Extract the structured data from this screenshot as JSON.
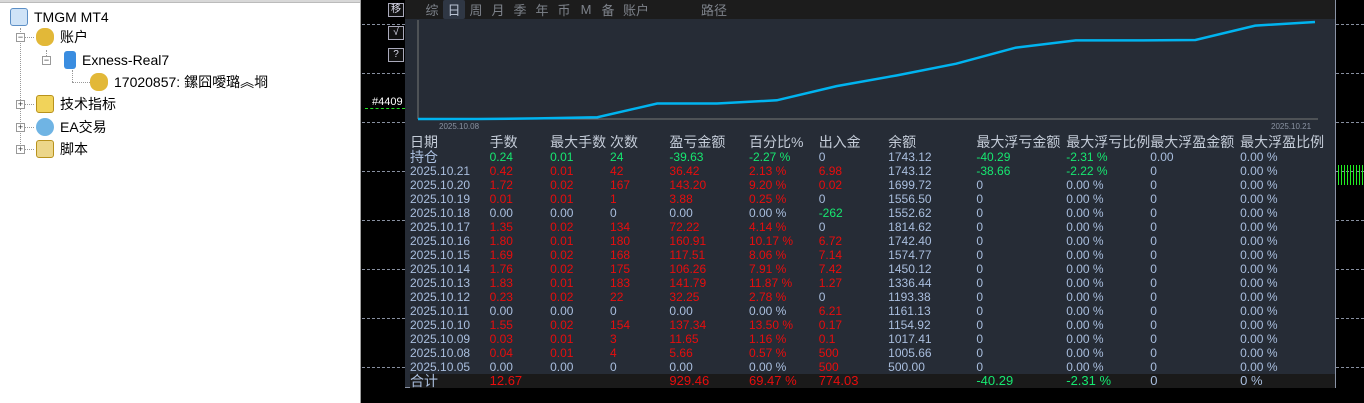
{
  "navigator": {
    "root": "TMGM MT4",
    "accounts": "账户",
    "server": "Exness-Real7",
    "account": "17020857: 鏍囧噯璐︽埛",
    "indicators": "技术指标",
    "experts": "EA交易",
    "scripts": "脚本"
  },
  "side_buttons": [
    "移",
    "√",
    "?"
  ],
  "chart_label": "#4409",
  "toolbar": [
    "综",
    "日",
    "周",
    "月",
    "季",
    "年",
    "币",
    "M",
    "备",
    "账户",
    "路径"
  ],
  "toolbar_active": "日",
  "equity_chart": {
    "start_label": "2025.10.08",
    "end_label": "2025.10.21",
    "line_color": "#00b4f0"
  },
  "colors": {
    "red": "#e80d0d",
    "green": "#16e870",
    "neutral": "#a9bede"
  },
  "headers": [
    "日期",
    "手数",
    "最大手数",
    "次数",
    "盈亏金额",
    "百分比%",
    "出入金",
    "余额",
    "最大浮亏金额",
    "最大浮亏比例",
    "最大浮盈金额",
    "最大浮盈比例"
  ],
  "rows": [
    {
      "c": [
        "持仓",
        "0.24",
        "0.01",
        "24",
        "-39.63",
        "-2.27 %",
        "0",
        "1743.12",
        "-40.29",
        "-2.31 %",
        "0.00",
        "0.00 %"
      ],
      "s": [
        "n",
        "g",
        "g",
        "g",
        "g",
        "g",
        "n",
        "n",
        "g",
        "g",
        "n",
        "n"
      ]
    },
    {
      "c": [
        "2025.10.21",
        "0.42",
        "0.01",
        "42",
        "36.42",
        "2.13 %",
        "6.98",
        "1743.12",
        "-38.66",
        "-2.22 %",
        "0",
        "0.00 %"
      ],
      "s": [
        "n",
        "r",
        "r",
        "r",
        "r",
        "r",
        "r",
        "n",
        "g",
        "g",
        "n",
        "n"
      ]
    },
    {
      "c": [
        "2025.10.20",
        "1.72",
        "0.02",
        "167",
        "143.20",
        "9.20 %",
        "0.02",
        "1699.72",
        "0",
        "0.00 %",
        "0",
        "0.00 %"
      ],
      "s": [
        "n",
        "r",
        "r",
        "r",
        "r",
        "r",
        "r",
        "n",
        "n",
        "n",
        "n",
        "n"
      ]
    },
    {
      "c": [
        "2025.10.19",
        "0.01",
        "0.01",
        "1",
        "3.88",
        "0.25 %",
        "0",
        "1556.50",
        "0",
        "0.00 %",
        "0",
        "0.00 %"
      ],
      "s": [
        "n",
        "r",
        "r",
        "r",
        "r",
        "r",
        "n",
        "n",
        "n",
        "n",
        "n",
        "n"
      ]
    },
    {
      "c": [
        "2025.10.18",
        "0.00",
        "0.00",
        "0",
        "0.00",
        "0.00 %",
        "-262",
        "1552.62",
        "0",
        "0.00 %",
        "0",
        "0.00 %"
      ],
      "s": [
        "n",
        "n",
        "n",
        "n",
        "n",
        "n",
        "g",
        "n",
        "n",
        "n",
        "n",
        "n"
      ]
    },
    {
      "c": [
        "2025.10.17",
        "1.35",
        "0.02",
        "134",
        "72.22",
        "4.14 %",
        "0",
        "1814.62",
        "0",
        "0.00 %",
        "0",
        "0.00 %"
      ],
      "s": [
        "n",
        "r",
        "r",
        "r",
        "r",
        "r",
        "n",
        "n",
        "n",
        "n",
        "n",
        "n"
      ]
    },
    {
      "c": [
        "2025.10.16",
        "1.80",
        "0.01",
        "180",
        "160.91",
        "10.17 %",
        "6.72",
        "1742.40",
        "0",
        "0.00 %",
        "0",
        "0.00 %"
      ],
      "s": [
        "n",
        "r",
        "r",
        "r",
        "r",
        "r",
        "r",
        "n",
        "n",
        "n",
        "n",
        "n"
      ]
    },
    {
      "c": [
        "2025.10.15",
        "1.69",
        "0.02",
        "168",
        "117.51",
        "8.06 %",
        "7.14",
        "1574.77",
        "0",
        "0.00 %",
        "0",
        "0.00 %"
      ],
      "s": [
        "n",
        "r",
        "r",
        "r",
        "r",
        "r",
        "r",
        "n",
        "n",
        "n",
        "n",
        "n"
      ]
    },
    {
      "c": [
        "2025.10.14",
        "1.76",
        "0.02",
        "175",
        "106.26",
        "7.91 %",
        "7.42",
        "1450.12",
        "0",
        "0.00 %",
        "0",
        "0.00 %"
      ],
      "s": [
        "n",
        "r",
        "r",
        "r",
        "r",
        "r",
        "r",
        "n",
        "n",
        "n",
        "n",
        "n"
      ]
    },
    {
      "c": [
        "2025.10.13",
        "1.83",
        "0.01",
        "183",
        "141.79",
        "11.87 %",
        "1.27",
        "1336.44",
        "0",
        "0.00 %",
        "0",
        "0.00 %"
      ],
      "s": [
        "n",
        "r",
        "r",
        "r",
        "r",
        "r",
        "r",
        "n",
        "n",
        "n",
        "n",
        "n"
      ]
    },
    {
      "c": [
        "2025.10.12",
        "0.23",
        "0.02",
        "22",
        "32.25",
        "2.78 %",
        "0",
        "1193.38",
        "0",
        "0.00 %",
        "0",
        "0.00 %"
      ],
      "s": [
        "n",
        "r",
        "r",
        "r",
        "r",
        "r",
        "n",
        "n",
        "n",
        "n",
        "n",
        "n"
      ]
    },
    {
      "c": [
        "2025.10.11",
        "0.00",
        "0.00",
        "0",
        "0.00",
        "0.00 %",
        "6.21",
        "1161.13",
        "0",
        "0.00 %",
        "0",
        "0.00 %"
      ],
      "s": [
        "n",
        "n",
        "n",
        "n",
        "n",
        "n",
        "r",
        "n",
        "n",
        "n",
        "n",
        "n"
      ]
    },
    {
      "c": [
        "2025.10.10",
        "1.55",
        "0.02",
        "154",
        "137.34",
        "13.50 %",
        "0.17",
        "1154.92",
        "0",
        "0.00 %",
        "0",
        "0.00 %"
      ],
      "s": [
        "n",
        "r",
        "r",
        "r",
        "r",
        "r",
        "r",
        "n",
        "n",
        "n",
        "n",
        "n"
      ]
    },
    {
      "c": [
        "2025.10.09",
        "0.03",
        "0.01",
        "3",
        "11.65",
        "1.16 %",
        "0.1",
        "1017.41",
        "0",
        "0.00 %",
        "0",
        "0.00 %"
      ],
      "s": [
        "n",
        "r",
        "r",
        "r",
        "r",
        "r",
        "r",
        "n",
        "n",
        "n",
        "n",
        "n"
      ]
    },
    {
      "c": [
        "2025.10.08",
        "0.04",
        "0.01",
        "4",
        "5.66",
        "0.57 %",
        "500",
        "1005.66",
        "0",
        "0.00 %",
        "0",
        "0.00 %"
      ],
      "s": [
        "n",
        "r",
        "r",
        "r",
        "r",
        "r",
        "r",
        "n",
        "n",
        "n",
        "n",
        "n"
      ]
    },
    {
      "c": [
        "2025.10.05",
        "0.00",
        "0.00",
        "0",
        "0.00",
        "0.00 %",
        "500",
        "500.00",
        "0",
        "0.00 %",
        "0",
        "0.00 %"
      ],
      "s": [
        "n",
        "n",
        "n",
        "n",
        "n",
        "n",
        "r",
        "n",
        "n",
        "n",
        "n",
        "n"
      ]
    }
  ],
  "total": {
    "c": [
      "合计",
      "12.67",
      "",
      "",
      "929.46",
      "69.47 %",
      "774.03",
      "",
      "-40.29",
      "-2.31 %",
      "0",
      "0 %"
    ],
    "s": [
      "n",
      "r",
      "n",
      "n",
      "r",
      "r",
      "r",
      "n",
      "g",
      "g",
      "n",
      "n"
    ]
  }
}
